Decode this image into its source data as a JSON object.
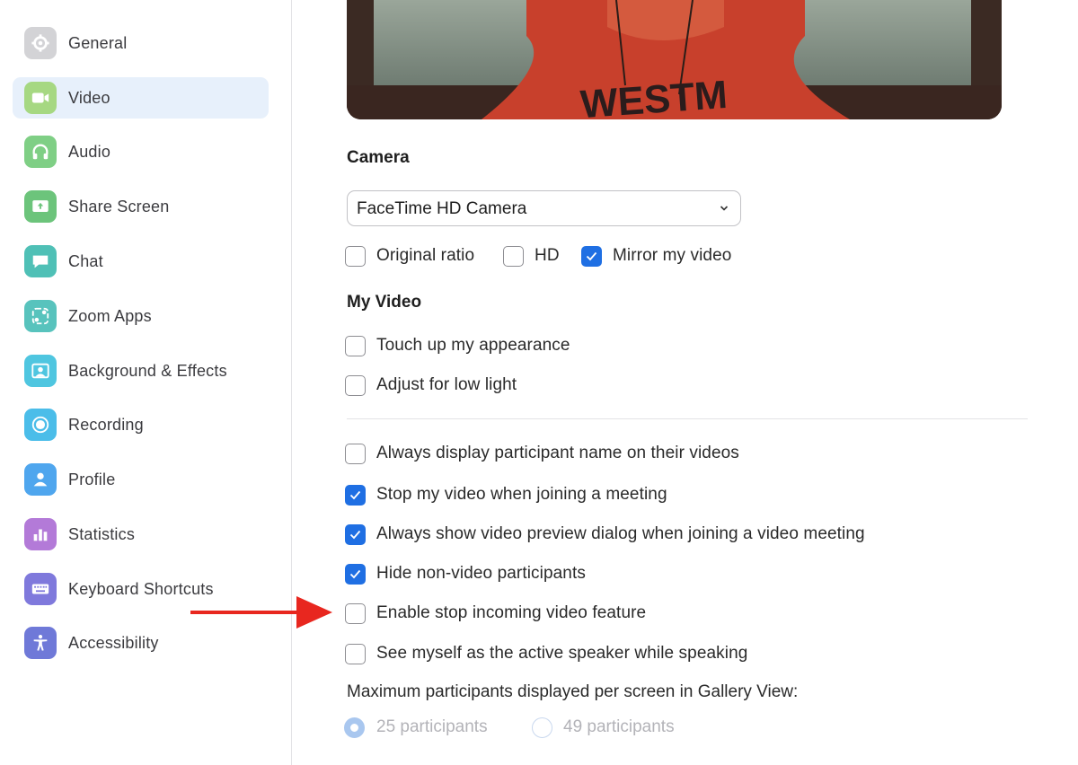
{
  "sidebar": {
    "items": [
      {
        "label": "General",
        "icon": "gear-icon",
        "color": "#d3d3d6",
        "active": false
      },
      {
        "label": "Video",
        "icon": "video-camera-icon",
        "color": "#a6d882",
        "active": true
      },
      {
        "label": "Audio",
        "icon": "headphones-icon",
        "color": "#7fcf85",
        "active": false
      },
      {
        "label": "Share Screen",
        "icon": "share-screen-icon",
        "color": "#6cc47b",
        "active": false
      },
      {
        "label": "Chat",
        "icon": "chat-bubble-icon",
        "color": "#4fc0b6",
        "active": false
      },
      {
        "label": "Zoom Apps",
        "icon": "apps-icon",
        "color": "#58c3bd",
        "active": false
      },
      {
        "label": "Background & Effects",
        "icon": "background-portrait-icon",
        "color": "#4fc6e0",
        "active": false
      },
      {
        "label": "Recording",
        "icon": "record-icon",
        "color": "#4bbde9",
        "active": false
      },
      {
        "label": "Profile",
        "icon": "person-icon",
        "color": "#4fa6ee",
        "active": false
      },
      {
        "label": "Statistics",
        "icon": "bar-chart-icon",
        "color": "#b37ad8",
        "active": false
      },
      {
        "label": "Keyboard Shortcuts",
        "icon": "keyboard-icon",
        "color": "#7f79dc",
        "active": false
      },
      {
        "label": "Accessibility",
        "icon": "accessibility-person-icon",
        "color": "#6f79d8",
        "active": false
      }
    ]
  },
  "camera": {
    "title": "Camera",
    "selected": "FaceTime HD Camera",
    "options": [
      {
        "label": "Original ratio",
        "checked": false
      },
      {
        "label": "HD",
        "checked": false
      },
      {
        "label": "Mirror my video",
        "checked": true
      }
    ]
  },
  "my_video": {
    "title": "My Video",
    "options": [
      {
        "label": "Touch up my appearance",
        "checked": false
      },
      {
        "label": "Adjust for low light",
        "checked": false
      }
    ]
  },
  "video_options": [
    {
      "label": "Always display participant name on their videos",
      "checked": false
    },
    {
      "label": "Stop my video when joining a meeting",
      "checked": true
    },
    {
      "label": "Always show video preview dialog when joining a video meeting",
      "checked": true
    },
    {
      "label": "Hide non-video participants",
      "checked": true
    },
    {
      "label": "Enable stop incoming video feature",
      "checked": false
    },
    {
      "label": "See myself as the active speaker while speaking",
      "checked": false
    }
  ],
  "gallery": {
    "label": "Maximum participants displayed per screen in Gallery View:",
    "options": [
      {
        "label": "25 participants",
        "selected": true
      },
      {
        "label": "49 participants",
        "selected": false
      }
    ]
  },
  "colors": {
    "accent": "#1f6fe3",
    "annotation_arrow": "#e8271f",
    "active_nav_bg": "#e7f0fb"
  }
}
